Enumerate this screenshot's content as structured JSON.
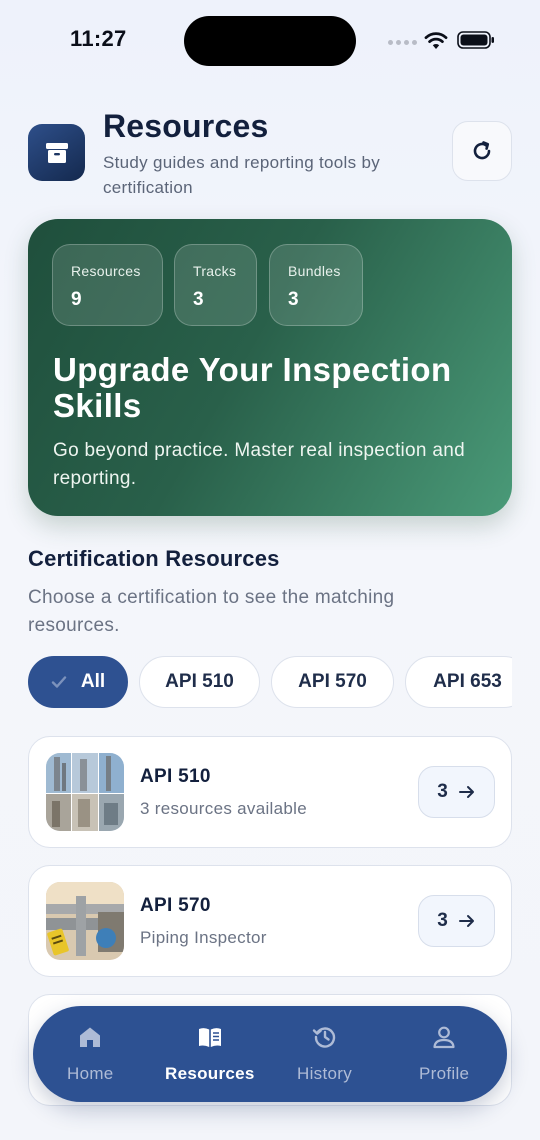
{
  "status_bar": {
    "time": "11:27"
  },
  "header": {
    "title": "Resources",
    "subtitle": "Study guides and reporting tools by certification",
    "app_icon": "archive-box-icon",
    "refresh_icon": "refresh-icon"
  },
  "hero": {
    "stats": [
      {
        "label": "Resources",
        "value": "9"
      },
      {
        "label": "Tracks",
        "value": "3"
      },
      {
        "label": "Bundles",
        "value": "3"
      }
    ],
    "title": "Upgrade Your Inspection Skills",
    "text": "Go beyond practice. Master real inspection and reporting."
  },
  "section": {
    "title": "Certification Resources",
    "description": "Choose a certification to see the matching resources."
  },
  "filters": {
    "chips": [
      {
        "label": "All",
        "active": true
      },
      {
        "label": "API 510",
        "active": false
      },
      {
        "label": "API 570",
        "active": false
      },
      {
        "label": "API 653",
        "active": false
      }
    ]
  },
  "cards": [
    {
      "title": "API 510",
      "subtitle": "3 resources available",
      "count": "3"
    },
    {
      "title": "API 570",
      "subtitle": "Piping Inspector",
      "count": "3"
    }
  ],
  "nav": {
    "items": [
      {
        "label": "Home",
        "icon": "home-icon",
        "active": false
      },
      {
        "label": "Resources",
        "icon": "book-icon",
        "active": true
      },
      {
        "label": "History",
        "icon": "history-icon",
        "active": false
      },
      {
        "label": "Profile",
        "icon": "profile-icon",
        "active": false
      }
    ]
  },
  "colors": {
    "primary": "#2d5192",
    "hero_start": "#1f4f3c",
    "hero_end": "#4a9a78",
    "text_dark": "#13203d",
    "text_muted": "#6b7384"
  }
}
